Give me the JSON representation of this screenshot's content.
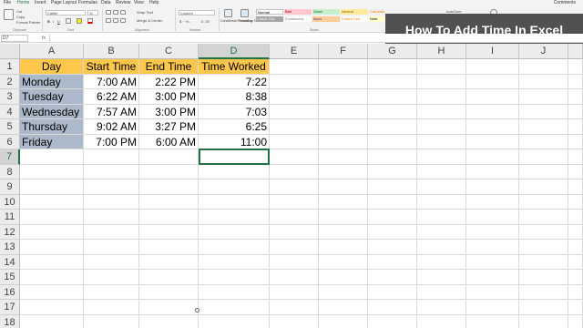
{
  "menu": {
    "items": [
      "File",
      "Home",
      "Insert",
      "Page Layout",
      "Formulas",
      "Data",
      "Review",
      "View",
      "Help"
    ],
    "active": "Home",
    "comments_label": "Comments"
  },
  "ribbon": {
    "clipboard": {
      "cut": "Cut",
      "copy": "Copy",
      "format_painter": "Format Painter",
      "group": "Clipboard"
    },
    "font": {
      "name": "Calibri",
      "size": "11",
      "group": "Font"
    },
    "alignment": {
      "wrap": "Wrap Text",
      "merge": "Merge & Center",
      "group": "Alignment"
    },
    "number": {
      "format": "Custom",
      "group": "Number"
    },
    "styles_cmds": {
      "conditional": "Conditional Formatting",
      "format_table": "Format as Table",
      "group": "Styles"
    },
    "styles": [
      "Normal",
      "Bad",
      "Good",
      "Neutral",
      "Calculation",
      "Check Cell",
      "Explanatory ...",
      "Input",
      "Linked Cell",
      "Note"
    ],
    "editing": {
      "autosum": "AutoSum",
      "group": "Editing"
    }
  },
  "banner": "How To Add Time In Excel",
  "formula_bar": {
    "name_box": "D7",
    "fx": "fx",
    "content": ""
  },
  "sheet": {
    "columns": [
      "A",
      "B",
      "C",
      "D",
      "E",
      "F",
      "G",
      "H",
      "I",
      "J"
    ],
    "selected_column": "D",
    "rows": [
      "1",
      "2",
      "3",
      "4",
      "5",
      "6",
      "7",
      "8",
      "9",
      "10",
      "11",
      "12",
      "13",
      "14",
      "15",
      "16",
      "17",
      "18"
    ],
    "selected_row": "7",
    "headers": [
      "Day",
      "Start Time",
      "End Time",
      "Time Worked"
    ],
    "data": [
      [
        "Monday",
        "7:00 AM",
        "2:22 PM",
        "7:22"
      ],
      [
        "Tuesday",
        "6:22 AM",
        "3:00 PM",
        "8:38"
      ],
      [
        "Wednesday",
        "7:57 AM",
        "3:00 PM",
        "7:03"
      ],
      [
        "Thursday",
        "9:02 AM",
        "3:27 PM",
        "6:25"
      ],
      [
        "Friday",
        "7:00 PM",
        "6:00 AM",
        "11:00"
      ]
    ]
  },
  "colors": {
    "header_fill": "#fcc74a",
    "day_fill": "#acb9ca",
    "accent": "#217346",
    "banner_bg": "#444444"
  }
}
